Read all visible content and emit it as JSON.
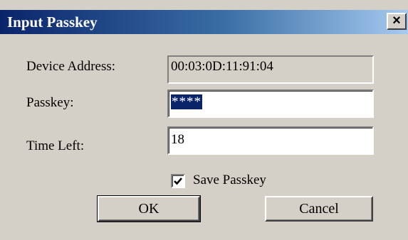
{
  "window": {
    "title": "Input Passkey",
    "close_glyph": "×"
  },
  "fields": {
    "device_address_label": "Device Address:",
    "device_address_value": "00:03:0D:11:91:04",
    "passkey_label": "Passkey:",
    "passkey_value": "****",
    "time_left_label": "Time Left:",
    "time_left_value": "18"
  },
  "options": {
    "save_passkey_label": "Save Passkey",
    "save_passkey_checked": true
  },
  "buttons": {
    "ok_label": "OK",
    "cancel_label": "Cancel"
  },
  "colors": {
    "title_bar_start": "#0a246a",
    "title_bar_end": "#a6caf0",
    "dialog_face": "#d4d0c8",
    "selection": "#0a246a"
  },
  "icons": {
    "close": "close-icon",
    "check": "checkmark-icon"
  }
}
